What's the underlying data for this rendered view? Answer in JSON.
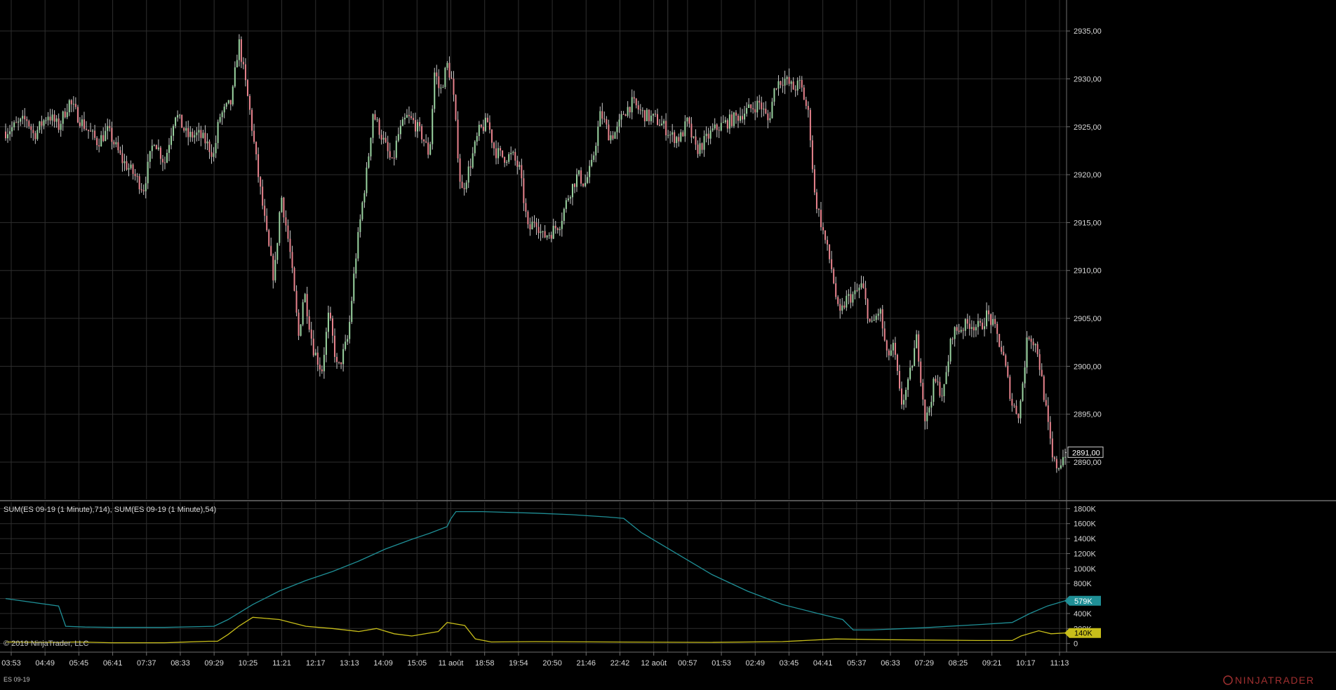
{
  "chart_data": [
    {
      "type": "candlestick",
      "instrument": "ES 09-19",
      "x_labels": [
        "03:53",
        "04:49",
        "05:45",
        "06:41",
        "07:37",
        "08:33",
        "09:29",
        "10:25",
        "11:21",
        "12:17",
        "13:13",
        "14:09",
        "15:05",
        "11 août",
        "18:58",
        "19:54",
        "20:50",
        "21:46",
        "22:42",
        "12 août",
        "00:57",
        "01:53",
        "02:49",
        "03:45",
        "04:41",
        "05:37",
        "06:33",
        "07:29",
        "08:25",
        "09:21",
        "10:17",
        "11:13"
      ],
      "y_ticks": [
        "2935,00",
        "2930,00",
        "2925,00",
        "2920,00",
        "2915,00",
        "2910,00",
        "2905,00",
        "2900,00",
        "2895,00",
        "2890,00"
      ],
      "ylim": [
        2887,
        2937.5
      ],
      "last_price_label": "2891,00",
      "last_price": 2891.0,
      "price_path": [
        [
          0,
          2924.5
        ],
        [
          1.2,
          2925.8
        ],
        [
          1.6,
          2924.1
        ],
        [
          2.4,
          2926.3
        ],
        [
          3.0,
          2925.0
        ],
        [
          3.6,
          2927.6
        ],
        [
          4.3,
          2925.5
        ],
        [
          5.2,
          2923.4
        ],
        [
          5.8,
          2924.6
        ],
        [
          6.6,
          2921.5
        ],
        [
          7.2,
          2920.2
        ],
        [
          7.8,
          2918.5
        ],
        [
          8.4,
          2923.8
        ],
        [
          9.0,
          2921.2
        ],
        [
          9.6,
          2926.5
        ],
        [
          10.3,
          2924.0
        ],
        [
          10.9,
          2924.2
        ],
        [
          11.3,
          2923.5
        ],
        [
          11.8,
          2922.0
        ],
        [
          12.1,
          2926.0
        ],
        [
          12.8,
          2927.6
        ],
        [
          13.2,
          2934.0
        ],
        [
          13.8,
          2927.0
        ],
        [
          14.3,
          2920.0
        ],
        [
          14.8,
          2913.5
        ],
        [
          15.2,
          2909.0
        ],
        [
          15.6,
          2918.0
        ],
        [
          16.1,
          2912.0
        ],
        [
          16.6,
          2903.0
        ],
        [
          16.9,
          2908.0
        ],
        [
          17.4,
          2902.0
        ],
        [
          17.9,
          2899.5
        ],
        [
          18.3,
          2905.5
        ],
        [
          18.8,
          2899.5
        ],
        [
          19.4,
          2903.0
        ],
        [
          19.8,
          2911.0
        ],
        [
          20.2,
          2917.0
        ],
        [
          20.5,
          2921.0
        ],
        [
          20.8,
          2926.5
        ],
        [
          21.2,
          2924.5
        ],
        [
          21.6,
          2922.5
        ],
        [
          21.9,
          2921.0
        ],
        [
          22.2,
          2924.0
        ],
        [
          22.7,
          2926.0
        ],
        [
          23.1,
          2925.5
        ],
        [
          23.6,
          2924.0
        ],
        [
          24.0,
          2922.0
        ],
        [
          24.3,
          2931.0
        ],
        [
          24.6,
          2928.5
        ],
        [
          25.0,
          2931.5
        ],
        [
          25.3,
          2929.5
        ],
        [
          25.8,
          2918.0
        ],
        [
          26.3,
          2921.0
        ],
        [
          26.8,
          2924.5
        ],
        [
          27.3,
          2925.5
        ],
        [
          27.7,
          2922.5
        ],
        [
          28.2,
          2921.8
        ],
        [
          28.7,
          2922.0
        ],
        [
          29.1,
          2920.5
        ],
        [
          29.6,
          2914.0
        ],
        [
          30.0,
          2915.5
        ],
        [
          30.4,
          2913.5
        ],
        [
          30.9,
          2914.0
        ],
        [
          31.4,
          2915.0
        ],
        [
          31.9,
          2918.0
        ],
        [
          32.4,
          2920.0
        ],
        [
          32.8,
          2919.0
        ],
        [
          33.2,
          2921.0
        ],
        [
          33.7,
          2926.5
        ],
        [
          34.2,
          2924.0
        ],
        [
          34.6,
          2924.5
        ],
        [
          35.0,
          2926.5
        ],
        [
          35.5,
          2927.5
        ],
        [
          36.0,
          2926.5
        ],
        [
          36.4,
          2926.0
        ],
        [
          36.8,
          2925.8
        ],
        [
          37.3,
          2925.0
        ],
        [
          37.7,
          2924.0
        ],
        [
          38.2,
          2923.8
        ],
        [
          38.6,
          2925.5
        ],
        [
          39.1,
          2922.5
        ],
        [
          39.6,
          2923.5
        ],
        [
          40.0,
          2924.5
        ],
        [
          40.4,
          2925.0
        ],
        [
          40.9,
          2925.5
        ],
        [
          41.4,
          2926.0
        ],
        [
          41.8,
          2926.5
        ],
        [
          42.3,
          2927.0
        ],
        [
          42.7,
          2927.5
        ],
        [
          43.2,
          2925.5
        ],
        [
          43.6,
          2929.5
        ],
        [
          44.1,
          2930.0
        ],
        [
          44.6,
          2929.0
        ],
        [
          45.0,
          2929.5
        ],
        [
          45.5,
          2926.0
        ],
        [
          45.8,
          2918.0
        ],
        [
          46.3,
          2914.0
        ],
        [
          46.8,
          2910.0
        ],
        [
          47.2,
          2905.0
        ],
        [
          47.6,
          2907.0
        ],
        [
          48.1,
          2907.5
        ],
        [
          48.5,
          2908.5
        ],
        [
          49.0,
          2904.0
        ],
        [
          49.5,
          2906.0
        ],
        [
          49.9,
          2901.0
        ],
        [
          50.3,
          2902.0
        ],
        [
          50.7,
          2896.0
        ],
        [
          51.1,
          2898.0
        ],
        [
          51.6,
          2903.0
        ],
        [
          52.1,
          2894.0
        ],
        [
          52.6,
          2898.5
        ],
        [
          53.1,
          2897.0
        ],
        [
          53.6,
          2903.5
        ],
        [
          54.1,
          2904.0
        ],
        [
          54.6,
          2904.5
        ],
        [
          55.2,
          2904.0
        ],
        [
          55.6,
          2905.5
        ],
        [
          56.1,
          2903.5
        ],
        [
          56.5,
          2901.0
        ],
        [
          57.0,
          2896.0
        ],
        [
          57.4,
          2895.0
        ],
        [
          57.9,
          2903.5
        ],
        [
          58.4,
          2902.0
        ],
        [
          58.8,
          2897.0
        ],
        [
          59.3,
          2890.0
        ],
        [
          59.6,
          2889.5
        ],
        [
          60.0,
          2891.0
        ]
      ],
      "volume_sum": {
        "title": "SUM(ES 09-19 (1 Minute),714), SUM(ES 09-19 (1 Minute),54)",
        "ylim": [
          -50000,
          1850000
        ],
        "y_ticks": [
          0,
          200000,
          400000,
          600000,
          800000,
          1000000,
          1200000,
          1400000,
          1600000,
          1800000
        ],
        "y_tick_labels": [
          "0",
          "200K",
          "400K",
          "600K",
          "800K",
          "1000K",
          "1200K",
          "1400K",
          "1600K",
          "1800K"
        ],
        "series": [
          {
            "name": "SUM(ES 09-19 (1 Minute),714)",
            "color": "#1f8f96",
            "last_label": "579K",
            "values": [
              [
                0,
                600000
              ],
              [
                3.0,
                500000
              ],
              [
                3.4,
                230000
              ],
              [
                4.5,
                220000
              ],
              [
                6.0,
                215000
              ],
              [
                9.0,
                215000
              ],
              [
                11.8,
                230000
              ],
              [
                12.6,
                320000
              ],
              [
                14.0,
                520000
              ],
              [
                15.5,
                700000
              ],
              [
                17.0,
                840000
              ],
              [
                18.5,
                960000
              ],
              [
                20.0,
                1100000
              ],
              [
                21.5,
                1260000
              ],
              [
                23.0,
                1390000
              ],
              [
                24.0,
                1470000
              ],
              [
                25.0,
                1560000
              ],
              [
                25.2,
                1660000
              ],
              [
                25.5,
                1760000
              ],
              [
                27.0,
                1760000
              ],
              [
                30.0,
                1740000
              ],
              [
                32.0,
                1720000
              ],
              [
                34.0,
                1690000
              ],
              [
                35.0,
                1670000
              ],
              [
                36.0,
                1480000
              ],
              [
                38.0,
                1200000
              ],
              [
                40.0,
                920000
              ],
              [
                42.0,
                700000
              ],
              [
                44.0,
                520000
              ],
              [
                46.0,
                400000
              ],
              [
                47.4,
                320000
              ],
              [
                48.0,
                180000
              ],
              [
                49.0,
                180000
              ],
              [
                52.0,
                210000
              ],
              [
                55.0,
                250000
              ],
              [
                57.0,
                280000
              ],
              [
                58.0,
                400000
              ],
              [
                59.0,
                500000
              ],
              [
                60.0,
                570000
              ]
            ]
          },
          {
            "name": "SUM(ES 09-19 (1 Minute),54)",
            "color": "#c8be1a",
            "last_label": "140K",
            "values": [
              [
                0,
                20000
              ],
              [
                3.0,
                15000
              ],
              [
                4.0,
                20000
              ],
              [
                6.0,
                10000
              ],
              [
                9.0,
                10000
              ],
              [
                11.5,
                30000
              ],
              [
                12.0,
                30000
              ],
              [
                12.6,
                120000
              ],
              [
                13.2,
                230000
              ],
              [
                14.0,
                350000
              ],
              [
                15.5,
                320000
              ],
              [
                17.0,
                230000
              ],
              [
                18.5,
                200000
              ],
              [
                20.0,
                160000
              ],
              [
                21.0,
                200000
              ],
              [
                22.0,
                130000
              ],
              [
                23.0,
                100000
              ],
              [
                24.5,
                160000
              ],
              [
                25.0,
                280000
              ],
              [
                26.0,
                240000
              ],
              [
                26.6,
                60000
              ],
              [
                27.5,
                20000
              ],
              [
                30.0,
                25000
              ],
              [
                34.0,
                20000
              ],
              [
                40.0,
                15000
              ],
              [
                44.0,
                25000
              ],
              [
                47.0,
                60000
              ],
              [
                50.0,
                50000
              ],
              [
                55.0,
                40000
              ],
              [
                57.0,
                40000
              ],
              [
                57.5,
                100000
              ],
              [
                58.5,
                170000
              ],
              [
                59.2,
                130000
              ],
              [
                60.0,
                140000
              ]
            ]
          }
        ]
      },
      "session_breaks": [
        25.0,
        37.5
      ],
      "colors": {
        "background": "#000000",
        "grid": "#2e2e2e",
        "up_body": "#9bd4a1",
        "down_body": "#e8838d",
        "wick": "#c8c8c8",
        "axis_text": "#d8d8d8",
        "separator": "#6e6e6e"
      },
      "copyright": "© 2019 NinjaTrader, LLC",
      "footer_label": "ES 09-19",
      "brand": "NINJATRADER"
    }
  ]
}
